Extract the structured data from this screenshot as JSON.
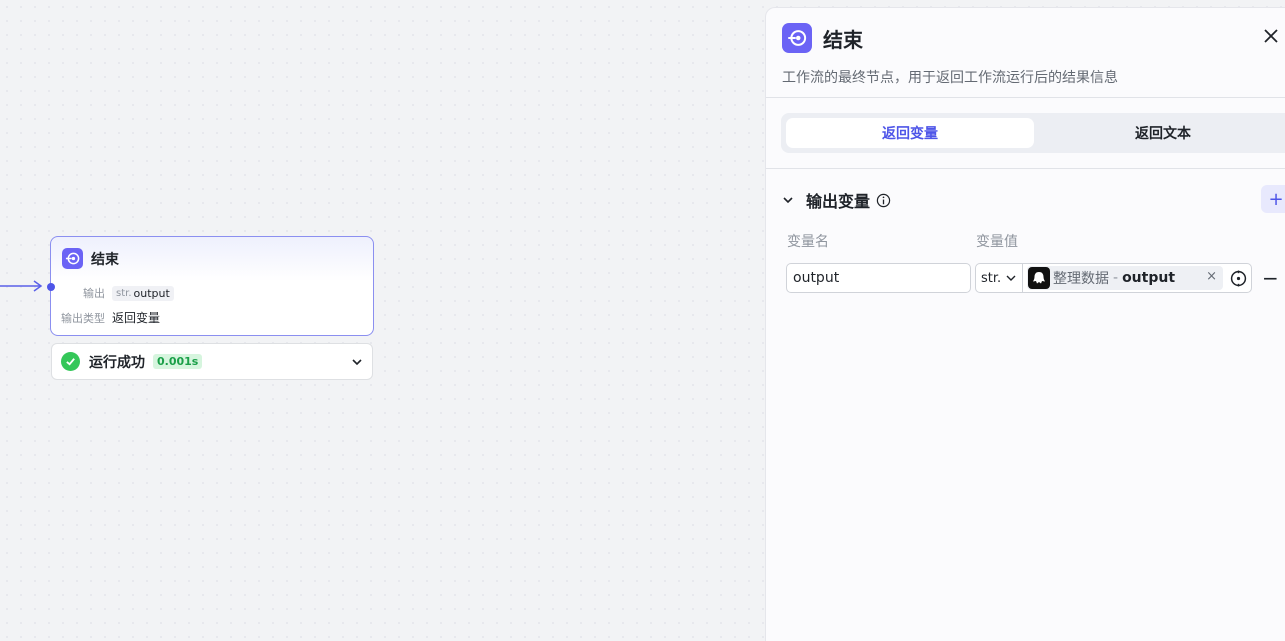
{
  "node": {
    "title": "结束",
    "output_label": "输出",
    "output_type": "str.",
    "output_var": "output",
    "mode_label": "输出类型",
    "mode_value": "返回变量"
  },
  "run_status": {
    "text": "运行成功",
    "duration": "0.001s"
  },
  "panel": {
    "title": "结束",
    "description": "工作流的最终节点，用于返回工作流运行后的结果信息",
    "tabs": [
      {
        "label": "返回变量",
        "active": true
      },
      {
        "label": "返回文本",
        "active": false
      }
    ],
    "section_title": "输出变量",
    "add_label": "+",
    "columns": {
      "name": "变量名",
      "value": "变量值"
    },
    "variable": {
      "name": "output",
      "type": "str.",
      "ref_node": "整理数据",
      "ref_sep": "-",
      "ref_var": "output"
    },
    "remove_label": "−"
  },
  "colors": {
    "accent": "#4e55e8",
    "node_badge": "#6b63f5",
    "success": "#34c759"
  }
}
